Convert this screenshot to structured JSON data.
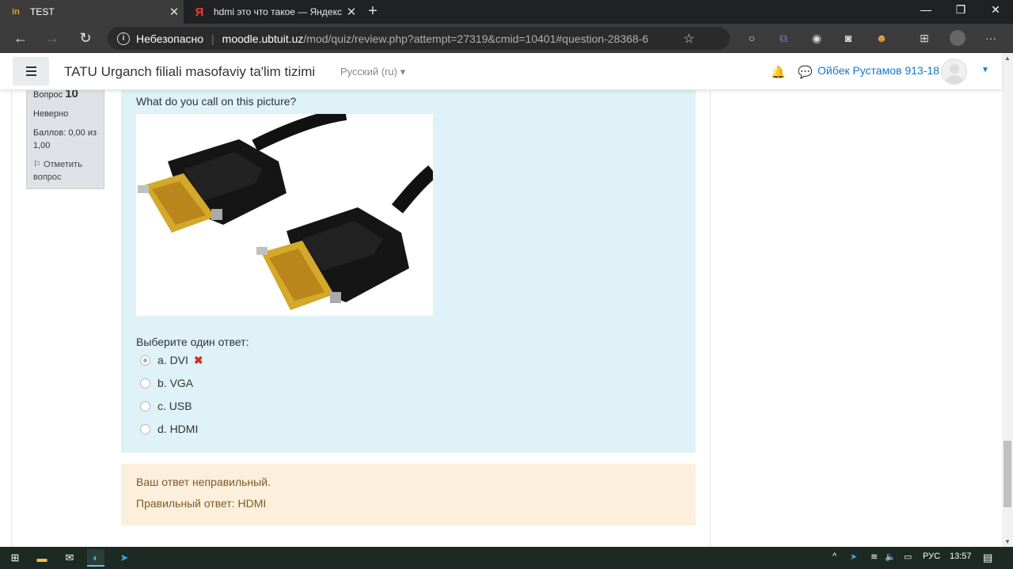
{
  "browser": {
    "tabs": [
      {
        "title": "TEST",
        "favicon": "in",
        "active": true
      },
      {
        "title": "hdmi это что такое — Яндекс: н",
        "favicon": "Я",
        "active": false
      }
    ],
    "security_label": "Небезопасно",
    "url_host": "moodle.ubtuit.uz",
    "url_path": "/mod/quiz/review.php?attempt=27319&cmid=10401#question-28368-6"
  },
  "header": {
    "site_name": "TATU Urganch filiali masofaviy ta'lim tizimi",
    "language": "Русский (ru)",
    "user_name": "Ойбек Рустамов 913-18"
  },
  "question_info": {
    "label": "Вопрос",
    "number": "10",
    "state": "Неверно",
    "grade_line1": "Баллов: 0,00 из",
    "grade_line2": "1,00",
    "flag_line1": "Отметить",
    "flag_line2": "вопрос"
  },
  "question": {
    "text": "What do you call on this picture?",
    "prompt": "Выберите один ответ:",
    "answers": [
      {
        "label": "a. DVI",
        "selected": true,
        "incorrect": true
      },
      {
        "label": "b. VGA",
        "selected": false
      },
      {
        "label": "c. USB",
        "selected": false
      },
      {
        "label": "d. HDMI",
        "selected": false
      }
    ],
    "wrong_mark": "✖"
  },
  "feedback": {
    "status": "Ваш ответ неправильный.",
    "correct_answer": "Правильный ответ: HDMI"
  },
  "taskbar": {
    "language": "РУС",
    "time": "13:57"
  },
  "colors": {
    "formulation_bg": "#def2f8",
    "feedback_bg": "#fcefdc",
    "link": "#1177d1",
    "incorrect": "#ca3120"
  },
  "icons": [
    "windows-icon",
    "folder-icon",
    "mail-icon",
    "edge-icon",
    "telegram-icon",
    "bell-icon",
    "chat-icon",
    "star-icon",
    "info-icon"
  ]
}
